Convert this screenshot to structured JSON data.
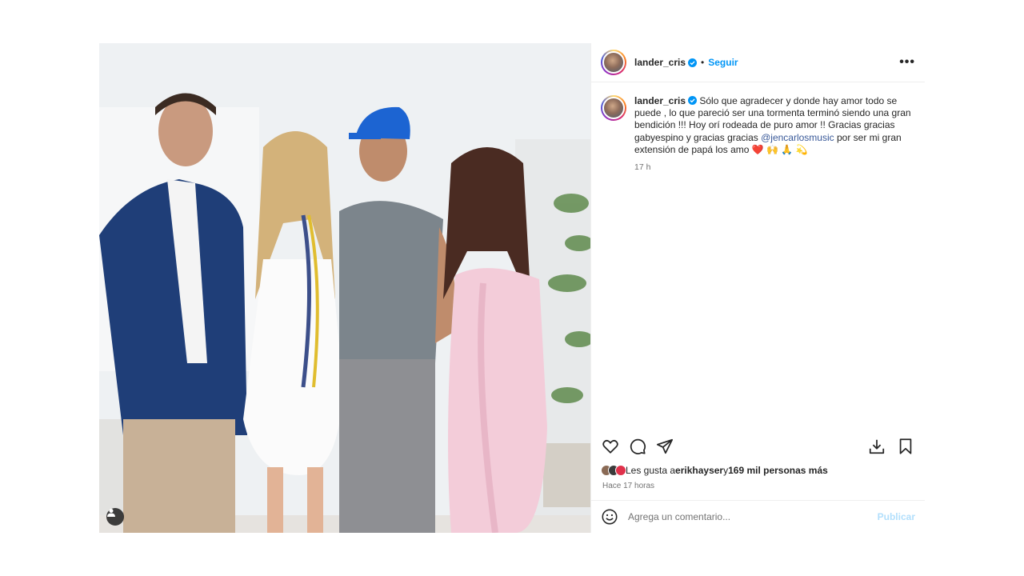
{
  "post": {
    "author": "lander_cris",
    "follow_label": "Seguir",
    "separator": "•",
    "more_label": "•••",
    "caption": {
      "part1": " Sólo que agradecer y donde hay amor todo se puede , lo que pareció ser una tormenta terminó siendo una gran bendición !!! Hoy orí rodeada de puro amor !! Gracias gracias gabyespino y gracias gracias ",
      "mention": "@jencarlosmusic",
      "part2": " por ser mi gran extensión de papá los amo ",
      "emojis": "❤️ 🙌 🙏 💫"
    },
    "caption_time": "17 h",
    "likes": {
      "prefix": "Les gusta a ",
      "user": "erikhayser",
      "middle": " y ",
      "count": "169 mil personas más"
    },
    "posted_ago": "Hace 17 horas",
    "comment_placeholder": "Agrega un comentario...",
    "publish_label": "Publicar"
  },
  "icons": [
    "verified-icon",
    "more-options-icon",
    "heart-icon",
    "comment-icon",
    "share-icon",
    "download-icon",
    "bookmark-icon",
    "emoji-icon",
    "user-tag-icon"
  ],
  "colors": {
    "link": "#0095f6",
    "mention": "#385898",
    "text": "#262626",
    "muted": "#737373",
    "publish_disabled": "#b2dffc"
  }
}
